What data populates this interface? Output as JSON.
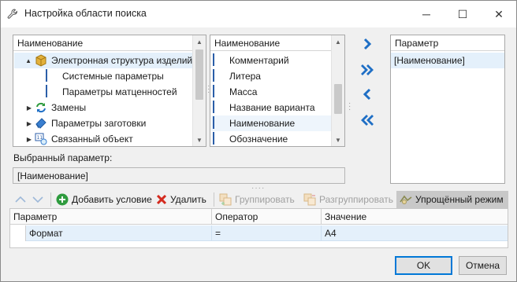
{
  "window": {
    "title": "Настройка области поиска",
    "controls": {
      "minimize": "─",
      "maximize": "☐",
      "close": "✕"
    }
  },
  "tree": {
    "header": "Наименование",
    "items": [
      {
        "label": "Электронная структура изделий",
        "icon": "product-structure-icon",
        "expander": "▲",
        "selected": true
      },
      {
        "label": "Системные параметры",
        "icon": "table-icon",
        "expander": ""
      },
      {
        "label": "Параметры матценностей",
        "icon": "table-icon",
        "expander": ""
      },
      {
        "label": "Замены",
        "icon": "replace-icon",
        "expander": "▶"
      },
      {
        "label": "Параметры заготовки",
        "icon": "blank-parameters-icon",
        "expander": "▶"
      },
      {
        "label": "Связанный объект",
        "icon": "linked-object-icon",
        "expander": "▶"
      }
    ]
  },
  "attributes": {
    "header": "Наименование",
    "items": [
      "Комментарий",
      "Литера",
      "Масса",
      "Название варианта",
      "Наименование",
      "Обозначение"
    ]
  },
  "transfer": {
    "add_one": "›",
    "add_all": "»",
    "remove_one": "‹",
    "remove_all": "«"
  },
  "selected_params": {
    "header": "Параметр",
    "items": [
      "[Наименование]"
    ]
  },
  "chosen": {
    "label": "Выбранный параметр:",
    "value": "[Наименование]"
  },
  "toolbar": {
    "up": "▲",
    "down": "▼",
    "add_condition": "Добавить условие",
    "delete": "Удалить",
    "group": "Группировать",
    "ungroup": "Разгруппировать",
    "simplified_mode": "Упрощённый режим"
  },
  "conditions": {
    "columns": [
      "Параметр",
      "Оператор",
      "Значение"
    ],
    "rows": [
      {
        "parameter": "Формат",
        "operator": "=",
        "value": "А4"
      }
    ]
  },
  "buttons": {
    "ok": "OK",
    "cancel": "Отмена"
  },
  "colors": {
    "accent": "#0078d7",
    "selection": "#e4f0fb",
    "arrow_blue": "#1f6fc5",
    "add_green": "#2e9b3e",
    "delete_red": "#d42a1e"
  }
}
